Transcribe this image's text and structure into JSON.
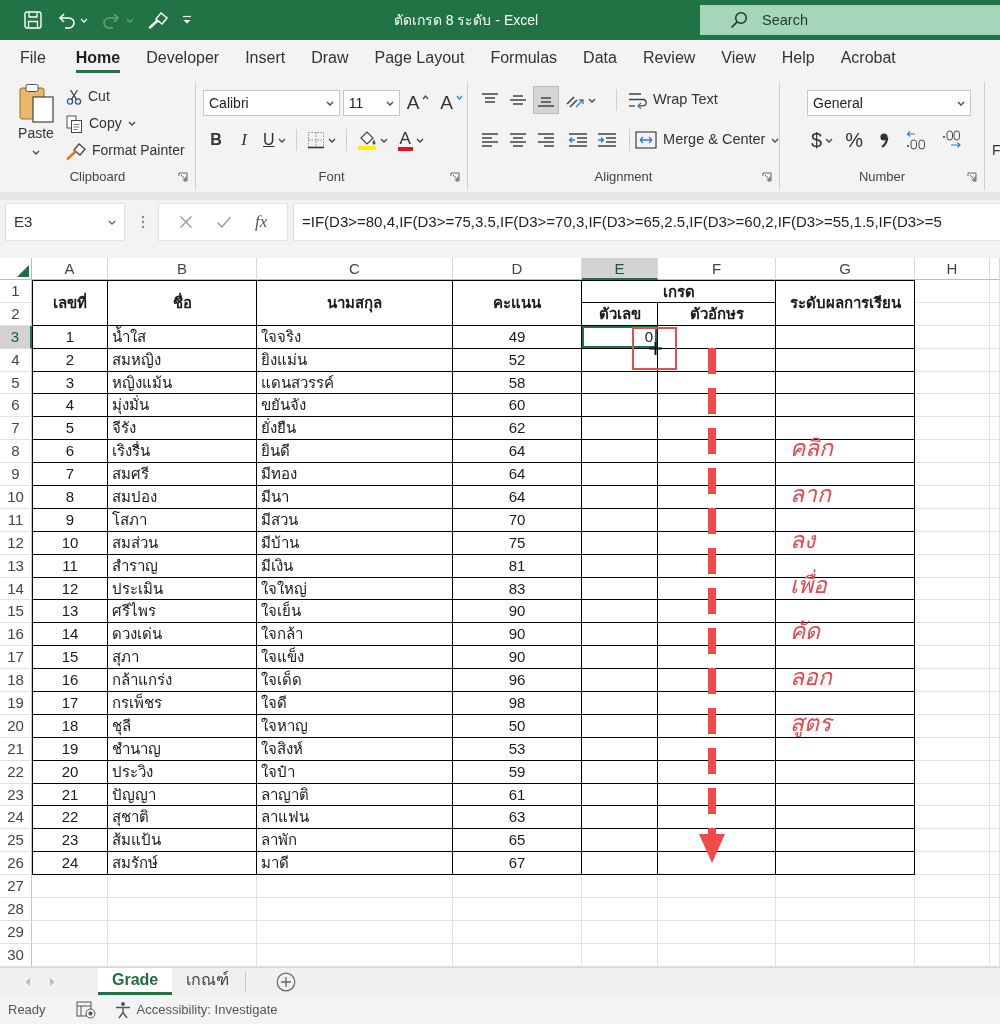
{
  "window": {
    "title": "ตัดเกรด 8 ระดับ - Excel"
  },
  "quick_access": [
    {
      "kind": "save",
      "disabled": false
    },
    {
      "kind": "undo",
      "disabled": false
    },
    {
      "kind": "redo",
      "disabled": true
    },
    {
      "kind": "brush",
      "disabled": false
    },
    {
      "kind": "customize",
      "disabled": false
    }
  ],
  "search": {
    "placeholder": "Search"
  },
  "ribbon_tabs": [
    {
      "label": "File",
      "selected": false
    },
    {
      "label": "Home",
      "selected": true
    },
    {
      "label": "Developer",
      "selected": false
    },
    {
      "label": "Insert",
      "selected": false
    },
    {
      "label": "Draw",
      "selected": false
    },
    {
      "label": "Page Layout",
      "selected": false
    },
    {
      "label": "Formulas",
      "selected": false
    },
    {
      "label": "Data",
      "selected": false
    },
    {
      "label": "Review",
      "selected": false
    },
    {
      "label": "View",
      "selected": false
    },
    {
      "label": "Help",
      "selected": false
    },
    {
      "label": "Acrobat",
      "selected": false
    }
  ],
  "ribbon": {
    "clipboard": {
      "paste": "Paste",
      "cut": "Cut",
      "copy": "Copy",
      "format_painter": "Format Painter",
      "label": "Clipboard"
    },
    "font": {
      "font_name": "Calibri",
      "font_size": "11",
      "grow_font": "A",
      "shrink_font": "A",
      "bold": "B",
      "italic": "I",
      "underline": "U",
      "font_color": "A",
      "label": "Font"
    },
    "alignment": {
      "top_row": [
        {
          "kind": "top",
          "selected": false
        },
        {
          "kind": "middle",
          "selected": false
        },
        {
          "kind": "bottom",
          "selected": true
        },
        {
          "kind": "orientation",
          "selected": false
        }
      ],
      "bottom_row": [
        {
          "kind": "left",
          "selected": false
        },
        {
          "kind": "center",
          "selected": false
        },
        {
          "kind": "right",
          "selected": false
        },
        {
          "kind": "decrease_indent",
          "selected": false
        },
        {
          "kind": "increase_indent",
          "selected": false
        }
      ],
      "wrap_text": "Wrap Text",
      "merge_center": "Merge & Center",
      "label": "Alignment"
    },
    "number": {
      "format": "General",
      "currency": "$",
      "percent": "%",
      "label": "Number"
    },
    "next_group": {
      "text": "F"
    }
  },
  "formula_bar": {
    "name_box": "E3",
    "insert_function": "fx",
    "formula": "=IF(D3>=80,4,IF(D3>=75,3.5,IF(D3>=70,3,IF(D3>=65,2.5,IF(D3>=60,2,IF(D3>=55,1.5,IF(D3>=5"
  },
  "columns": [
    {
      "label": "A",
      "selected": false
    },
    {
      "label": "B",
      "selected": false
    },
    {
      "label": "C",
      "selected": false
    },
    {
      "label": "D",
      "selected": false
    },
    {
      "label": "E",
      "selected": true
    },
    {
      "label": "F",
      "selected": false
    },
    {
      "label": "G",
      "selected": false
    },
    {
      "label": "H",
      "selected": false
    }
  ],
  "rows": [
    {
      "label": "1",
      "selected": false
    },
    {
      "label": "2",
      "selected": false
    },
    {
      "label": "3",
      "selected": true
    },
    {
      "label": "4",
      "selected": false
    },
    {
      "label": "5",
      "selected": false
    },
    {
      "label": "6",
      "selected": false
    },
    {
      "label": "7",
      "selected": false
    },
    {
      "label": "8",
      "selected": false
    },
    {
      "label": "9",
      "selected": false
    },
    {
      "label": "10",
      "selected": false
    },
    {
      "label": "11",
      "selected": false
    },
    {
      "label": "12",
      "selected": false
    },
    {
      "label": "13",
      "selected": false
    },
    {
      "label": "14",
      "selected": false
    },
    {
      "label": "15",
      "selected": false
    },
    {
      "label": "16",
      "selected": false
    },
    {
      "label": "17",
      "selected": false
    },
    {
      "label": "18",
      "selected": false
    },
    {
      "label": "19",
      "selected": false
    },
    {
      "label": "20",
      "selected": false
    },
    {
      "label": "21",
      "selected": false
    },
    {
      "label": "22",
      "selected": false
    },
    {
      "label": "23",
      "selected": false
    },
    {
      "label": "24",
      "selected": false
    },
    {
      "label": "25",
      "selected": false
    },
    {
      "label": "26",
      "selected": false
    },
    {
      "label": "27",
      "selected": false
    },
    {
      "label": "28",
      "selected": false
    },
    {
      "label": "29",
      "selected": false
    },
    {
      "label": "30",
      "selected": false
    }
  ],
  "table": {
    "headers": {
      "number": "เลขที่",
      "first_name": "ชื่อ",
      "last_name": "นามสกุล",
      "score": "คะแนน",
      "grade": "เกรด",
      "grade_numeric": "ตัวเลข",
      "grade_letter": "ตัวอักษร",
      "result_level": "ระดับผลการเรียน"
    },
    "students": [
      {
        "number": "1",
        "first_name": "น้ำใส",
        "last_name": "ใจจริง",
        "score": "49",
        "grade_numeric": "0"
      },
      {
        "number": "2",
        "first_name": "สมหญิง",
        "last_name": "ยิงแม่น",
        "score": "52"
      },
      {
        "number": "3",
        "first_name": "หญิงแม้น",
        "last_name": "แดนสวรรค์",
        "score": "58"
      },
      {
        "number": "4",
        "first_name": "มุ่งมั่น",
        "last_name": "ขยันจัง",
        "score": "60"
      },
      {
        "number": "5",
        "first_name": "จีรัง",
        "last_name": "ยั่งยืน",
        "score": "62"
      },
      {
        "number": "6",
        "first_name": "เริงรื่น",
        "last_name": "ยินดี",
        "score": "64"
      },
      {
        "number": "7",
        "first_name": "สมศรี",
        "last_name": "มีทอง",
        "score": "64"
      },
      {
        "number": "8",
        "first_name": "สมปอง",
        "last_name": "มีนา",
        "score": "64"
      },
      {
        "number": "9",
        "first_name": "โสภา",
        "last_name": "มีสวน",
        "score": "70"
      },
      {
        "number": "10",
        "first_name": "สมส่วน",
        "last_name": "มีบ้าน",
        "score": "75"
      },
      {
        "number": "11",
        "first_name": "สำราญ",
        "last_name": "มีเงิน",
        "score": "81"
      },
      {
        "number": "12",
        "first_name": "ประเมิน",
        "last_name": "ใจใหญ่",
        "score": "83"
      },
      {
        "number": "13",
        "first_name": "ศรีไพร",
        "last_name": "ใจเย็น",
        "score": "90"
      },
      {
        "number": "14",
        "first_name": "ดวงเด่น",
        "last_name": "ใจกล้า",
        "score": "90"
      },
      {
        "number": "15",
        "first_name": "สุภา",
        "last_name": "ใจแข็ง",
        "score": "90"
      },
      {
        "number": "16",
        "first_name": "กล้าแกร่ง",
        "last_name": "ใจเด็ด",
        "score": "96"
      },
      {
        "number": "17",
        "first_name": "กรเพ็ชร",
        "last_name": "ใจดี",
        "score": "98"
      },
      {
        "number": "18",
        "first_name": "ชุลี",
        "last_name": "ใจหาญ",
        "score": "50"
      },
      {
        "number": "19",
        "first_name": "ชำนาญ",
        "last_name": "ใจสิงห์",
        "score": "53"
      },
      {
        "number": "20",
        "first_name": "ประวิง",
        "last_name": "ใจป๋า",
        "score": "59"
      },
      {
        "number": "21",
        "first_name": "ปัญญา",
        "last_name": "ลาญาติ",
        "score": "61"
      },
      {
        "number": "22",
        "first_name": "สุชาติ",
        "last_name": "ลาแฟน",
        "score": "63"
      },
      {
        "number": "23",
        "first_name": "ส้มแป้น",
        "last_name": "ลาพัก",
        "score": "65"
      },
      {
        "number": "24",
        "first_name": "สมรักษ์",
        "last_name": "มาดี",
        "score": "67"
      }
    ]
  },
  "annotation": {
    "words": [
      "คลิก",
      "ลาก",
      "ลง",
      "เพื่อ",
      "คัด",
      "ลอก",
      "สูตร"
    ]
  },
  "sheet_tabs": [
    {
      "label": "Grade",
      "selected": true
    },
    {
      "label": "เกณฑ์",
      "selected": false
    }
  ],
  "status_bar": {
    "status": "Ready",
    "accessibility": "Accessibility: Investigate"
  }
}
